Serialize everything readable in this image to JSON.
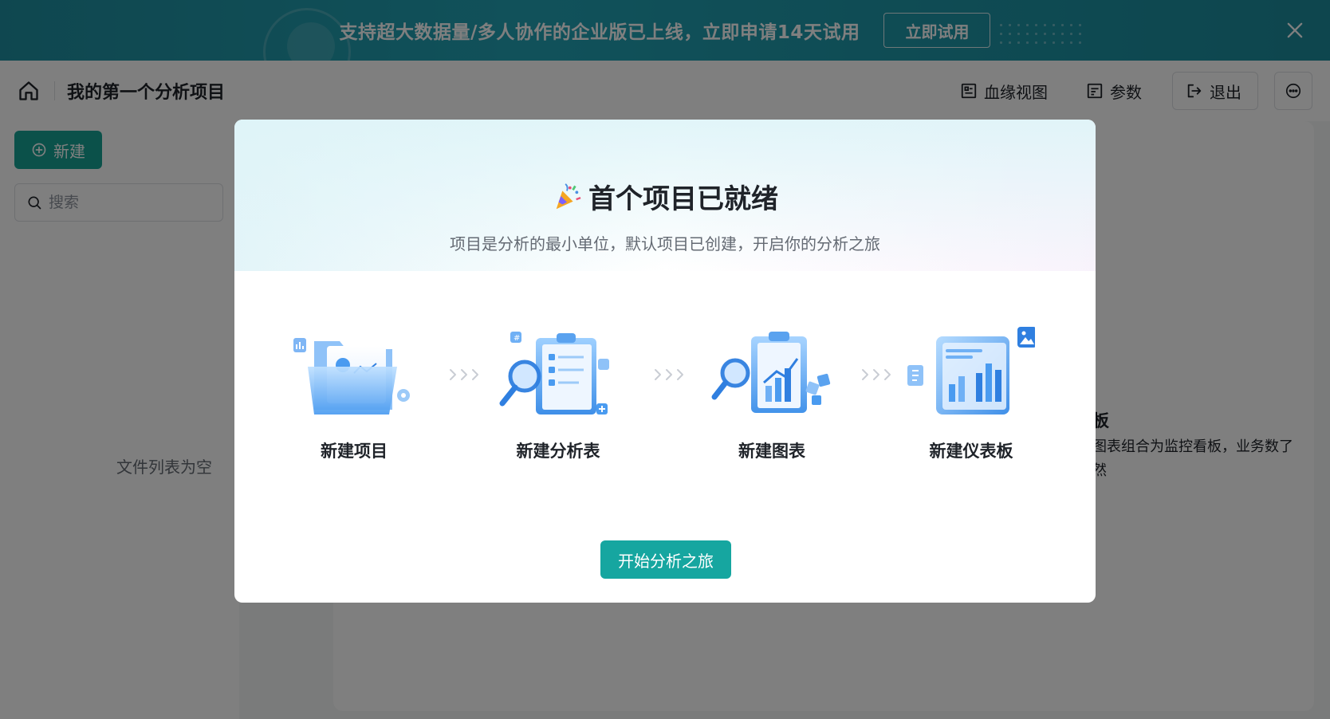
{
  "banner": {
    "text": "支持超大数据量/多人协作的企业版已上线，立即申请14天试用",
    "button_label": "立即试用",
    "close_icon": "close-icon",
    "bg_color": "#1f9aab"
  },
  "header": {
    "project_title": "我的第一个分析项目",
    "lineage_label": "血缘视图",
    "params_label": "参数",
    "exit_label": "退出"
  },
  "sidebar": {
    "new_label": "新建",
    "search_placeholder": "搜索",
    "empty_text": "文件列表为空"
  },
  "main_peek": {
    "title": "板",
    "desc": "图表组合为监控看板，业务数了然"
  },
  "modal": {
    "title": "首个项目已就绪",
    "subtitle": "项目是分析的最小单位，默认项目已创建，开启你的分析之旅",
    "steps": [
      {
        "label": "新建项目",
        "icon": "folder-illustration"
      },
      {
        "label": "新建分析表",
        "icon": "clipboard-search-illustration"
      },
      {
        "label": "新建图表",
        "icon": "chart-clipboard-illustration"
      },
      {
        "label": "新建仪表板",
        "icon": "dashboard-illustration"
      }
    ],
    "start_label": "开始分析之旅"
  },
  "colors": {
    "accent": "#16a394",
    "modal_button": "#16a6a0",
    "illustration_blue": "#4a90e2"
  }
}
